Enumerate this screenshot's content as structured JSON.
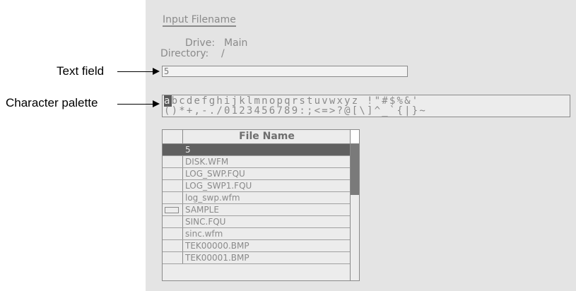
{
  "dialog": {
    "title": "Input Filename",
    "drive_label": "Drive:",
    "drive_value": "Main",
    "directory_label": "Directory:",
    "directory_value": "/"
  },
  "text_field": {
    "value": "5"
  },
  "palette": {
    "selected_char": "a",
    "row1_rest": "bcdefghijklmnopqrstuvwxyz !\"#$%&'",
    "row2": "()*+,-./0123456789:;<=>?@[\\]^_`{|}~"
  },
  "callouts": {
    "text_field": "Text field",
    "character_palette": "Character palette"
  },
  "file_table": {
    "header": "File Name",
    "rows": [
      {
        "name": "5",
        "selected": true,
        "folder": false
      },
      {
        "name": "DISK.WFM",
        "selected": false,
        "folder": false
      },
      {
        "name": "LOG_SWP.FQU",
        "selected": false,
        "folder": false
      },
      {
        "name": "LOG_SWP1.FQU",
        "selected": false,
        "folder": false
      },
      {
        "name": "log_swp.wfm",
        "selected": false,
        "folder": false
      },
      {
        "name": "SAMPLE",
        "selected": false,
        "folder": true
      },
      {
        "name": "SINC.FQU",
        "selected": false,
        "folder": false
      },
      {
        "name": "sinc.wfm",
        "selected": false,
        "folder": false
      },
      {
        "name": "TEK00000.BMP",
        "selected": false,
        "folder": false
      },
      {
        "name": "TEK00001.BMP",
        "selected": false,
        "folder": false
      }
    ]
  },
  "colors": {
    "screen_bg": "#e4e4e4",
    "text_gray": "#8a8a8a",
    "selection": "#606060"
  }
}
